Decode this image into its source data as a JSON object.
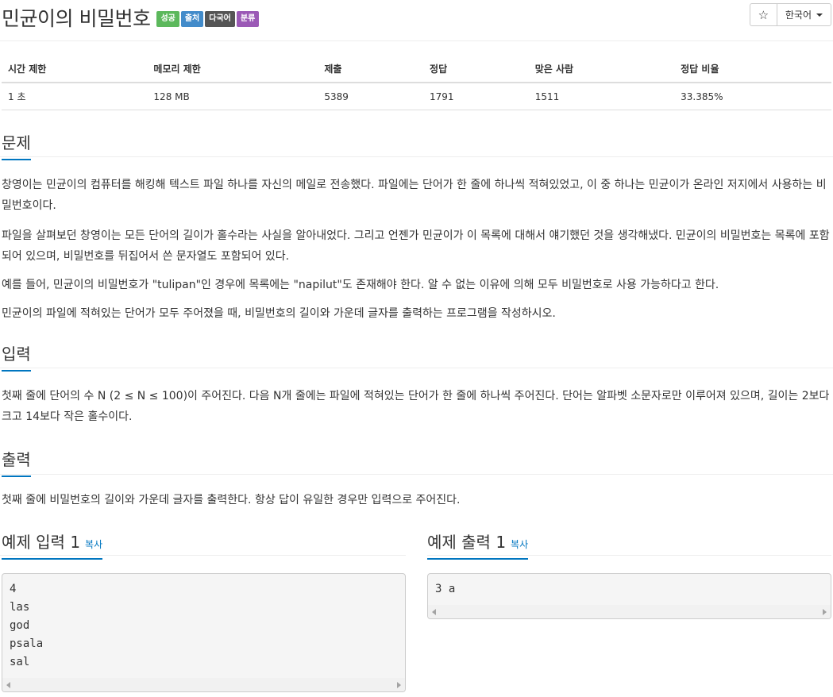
{
  "header": {
    "title": "민균이의 비밀번호",
    "badges": [
      {
        "label": "성공",
        "color": "#5cb85c"
      },
      {
        "label": "출처",
        "color": "#428bca"
      },
      {
        "label": "다국어",
        "color": "#555555"
      },
      {
        "label": "분류",
        "color": "#9b59b6"
      }
    ],
    "star_icon": "☆",
    "language": "한국어"
  },
  "info_table": {
    "headers": [
      "시간 제한",
      "메모리 제한",
      "제출",
      "정답",
      "맞은 사람",
      "정답 비율"
    ],
    "values": [
      "1 초",
      "128 MB",
      "5389",
      "1791",
      "1511",
      "33.385%"
    ]
  },
  "problem": {
    "heading": "문제",
    "paragraphs": [
      "창영이는 민균이의 컴퓨터를 해킹해 텍스트 파일 하나를 자신의 메일로 전송했다. 파일에는 단어가 한 줄에 하나씩 적혀있었고, 이 중 하나는 민균이가 온라인 저지에서 사용하는 비밀번호이다.",
      "파일을 살펴보던 창영이는 모든 단어의 길이가 홀수라는 사실을 알아내었다. 그리고 언젠가 민균이가 이 목록에 대해서 얘기했던 것을 생각해냈다. 민균이의 비밀번호는 목록에 포함되어 있으며, 비밀번호를 뒤집어서 쓴 문자열도 포함되어 있다.",
      "예를 들어, 민균이의 비밀번호가 \"tulipan\"인 경우에 목록에는 \"napilut\"도 존재해야 한다. 알 수 없는 이유에 의해 모두 비밀번호로 사용 가능하다고 한다.",
      "민균이의 파일에 적혀있는 단어가 모두 주어졌을 때, 비밀번호의 길이와 가운데 글자를 출력하는 프로그램을 작성하시오."
    ]
  },
  "input": {
    "heading": "입력",
    "text": "첫째 줄에 단어의 수 N (2 ≤ N ≤ 100)이 주어진다. 다음 N개 줄에는 파일에 적혀있는 단어가 한 줄에 하나씩 주어진다. 단어는 알파벳 소문자로만 이루어져 있으며, 길이는 2보다 크고 14보다 작은 홀수이다."
  },
  "output": {
    "heading": "출력",
    "text": "첫째 줄에 비밀번호의 길이와 가운데 글자를 출력한다. 항상 답이 유일한 경우만 입력으로 주어진다."
  },
  "sample_input": {
    "heading": "예제 입력 1",
    "copy_label": "복사",
    "text": "4\nlas\ngod\npsala\nsal"
  },
  "sample_output": {
    "heading": "예제 출력 1",
    "copy_label": "복사",
    "text": "3 a"
  }
}
